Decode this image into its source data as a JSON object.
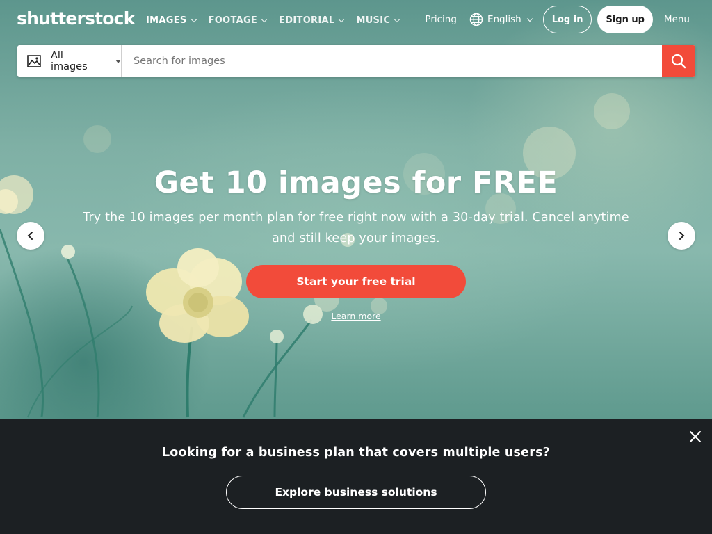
{
  "header": {
    "logo": "shutterstock",
    "nav": [
      {
        "label": "IMAGES",
        "active": true
      },
      {
        "label": "FOOTAGE",
        "active": false
      },
      {
        "label": "EDITORIAL",
        "active": false
      },
      {
        "label": "MUSIC",
        "active": false
      }
    ],
    "pricing": "Pricing",
    "language": "English",
    "login": "Log in",
    "signup": "Sign up",
    "menu": "Menu"
  },
  "search": {
    "type": "All images",
    "placeholder": "Search for images",
    "value": ""
  },
  "hero": {
    "title": "Get 10 images for FREE",
    "subtitle": "Try the 10 images per month plan for free right now with a 30-day trial. Cancel anytime and still keep your images.",
    "cta": "Start your free trial",
    "learn_more": "Learn more"
  },
  "banner": {
    "title": "Looking for a business plan that covers multiple users?",
    "button": "Explore business solutions"
  },
  "colors": {
    "accent": "#f24b3a",
    "banner_bg": "#1c2023",
    "hero_bg": "#7fb0a5"
  },
  "icons": [
    "image-icon",
    "globe-icon",
    "search-icon",
    "chevron-left-icon",
    "chevron-right-icon",
    "close-icon"
  ]
}
